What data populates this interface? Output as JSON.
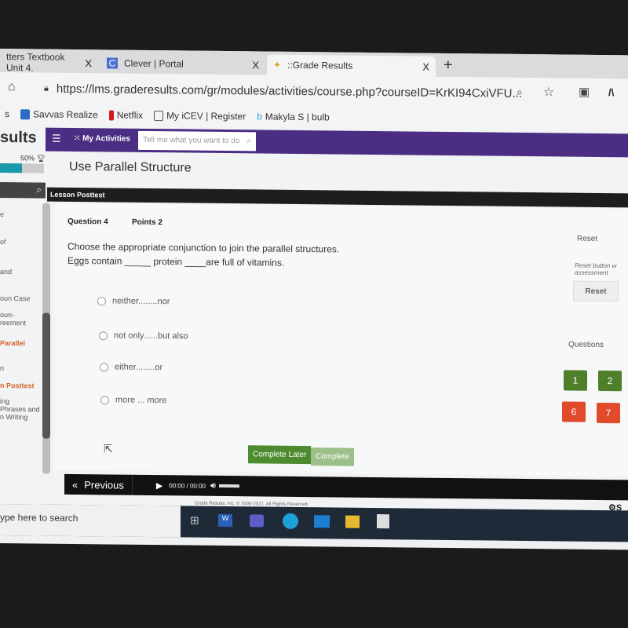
{
  "browser": {
    "tabs": [
      {
        "label": "tters Textbook Unit 4.",
        "close": "X"
      },
      {
        "label": "Clever | Portal",
        "close": "X"
      },
      {
        "label": "::Grade Results",
        "close": "X",
        "active": true
      }
    ],
    "new_tab": "+",
    "url": "https://lms.graderesults.com/gr/modules/activities/course.php?courseID=KrKI94CxiVFU...",
    "bookmarks": [
      {
        "label": "s",
        "icon": ""
      },
      {
        "label": "Savvas Realize",
        "icon": "savvas-icon"
      },
      {
        "label": "Netflix",
        "icon": "netflix-icon"
      },
      {
        "label": "My iCEV | Register",
        "icon": "page-icon"
      },
      {
        "label": "Makyla S | bulb",
        "icon": "bulb-icon"
      }
    ]
  },
  "app": {
    "logo": "sults",
    "nav_label": "My Activities",
    "search_placeholder": "Tell me what you want to do",
    "progress_label": "50%",
    "progress": 50,
    "page_title": "Use Parallel Structure",
    "section": "Lesson Posttest",
    "sidebar": [
      "e",
      "of",
      "and",
      "oun Case",
      "oun-\nreement",
      "Parallel",
      "n",
      "n Posttest",
      "ing\nPhrases and\nn Writing"
    ],
    "accent": "#4b2e83"
  },
  "question": {
    "number": "Question 4",
    "points": "Points 2",
    "prompt": "Choose the appropriate conjunction to join the parallel structures.",
    "sentence": "Eggs contain _____ protein ____are full of vitamins.",
    "options": [
      "neither........nor",
      "not only......but also",
      "either........or",
      "more ... more"
    ]
  },
  "right": {
    "reset_link": "Reset",
    "reset_note": "Reset button w\nassessment",
    "reset_button": "Reset",
    "questions_label": "Questions",
    "question_buttons": [
      {
        "n": "1",
        "status": "green"
      },
      {
        "n": "2",
        "status": "green"
      },
      {
        "n": "6",
        "status": "red"
      },
      {
        "n": "7",
        "status": "red"
      }
    ]
  },
  "actions": {
    "complete_later": "Complete Later",
    "complete": "Complete"
  },
  "player": {
    "previous": "Previous",
    "time": "00:00 / 00:00"
  },
  "footer": {
    "copyright": "Grade Results, Inc. © 2005-2021. All Rights Reserved.",
    "settings": "S"
  },
  "taskbar": {
    "search_placeholder": "ype here to search"
  }
}
